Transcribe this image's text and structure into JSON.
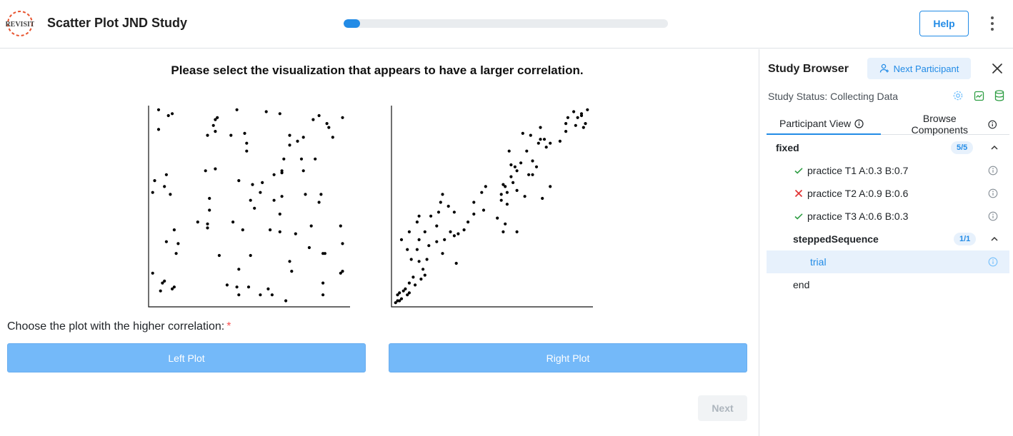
{
  "header": {
    "logo_text": "REVISIT",
    "title": "Scatter Plot JND Study",
    "progress_fraction": 0.05,
    "help_label": "Help",
    "menu_icon": "dots-vertical-icon"
  },
  "main": {
    "prompt": "Please select the visualization that appears to have a larger correlation.",
    "question": "Choose the plot with the higher correlation:",
    "required_mark": "*",
    "left_choice": "Left Plot",
    "right_choice": "Right Plot",
    "next_label": "Next"
  },
  "sidebar": {
    "title": "Study Browser",
    "next_participant_label": "Next Participant",
    "status": "Study Status: Collecting Data",
    "tabs": [
      {
        "label": "Participant View"
      },
      {
        "label": "Browse Components"
      }
    ],
    "tree": [
      {
        "label": "fixed",
        "type": "block",
        "badge": "5/5"
      },
      {
        "label": "practice T1 A:0.3 B:0.7",
        "type": "item",
        "result": "correct"
      },
      {
        "label": "practice T2 A:0.9 B:0.6",
        "type": "item",
        "result": "wrong"
      },
      {
        "label": "practice T3 A:0.6 B:0.3",
        "type": "item",
        "result": "correct"
      },
      {
        "label": "steppedSequence",
        "type": "block",
        "badge": "1/1"
      },
      {
        "label": "trial",
        "type": "item",
        "result": "active"
      },
      {
        "label": "end",
        "type": "plain"
      }
    ],
    "colors": {
      "accent": "#228be6",
      "correct": "#2f9e44",
      "wrong": "#e03131"
    }
  },
  "chart_data": [
    {
      "type": "scatter",
      "xlim": [
        0,
        1
      ],
      "ylim": [
        0,
        1
      ],
      "points": [
        [
          0.04,
          0.99
        ],
        [
          0.09,
          0.96
        ],
        [
          0.11,
          0.97
        ],
        [
          0.04,
          0.89
        ],
        [
          0.34,
          0.95
        ],
        [
          0.33,
          0.94
        ],
        [
          0.32,
          0.91
        ],
        [
          0.44,
          0.99
        ],
        [
          0.59,
          0.98
        ],
        [
          0.66,
          0.97
        ],
        [
          0.86,
          0.96
        ],
        [
          0.9,
          0.92
        ],
        [
          0.91,
          0.9
        ],
        [
          0.98,
          0.95
        ],
        [
          0.83,
          0.94
        ],
        [
          0.33,
          0.88
        ],
        [
          0.29,
          0.86
        ],
        [
          0.41,
          0.86
        ],
        [
          0.48,
          0.87
        ],
        [
          0.49,
          0.82
        ],
        [
          0.49,
          0.78
        ],
        [
          0.71,
          0.86
        ],
        [
          0.78,
          0.85
        ],
        [
          0.75,
          0.83
        ],
        [
          0.71,
          0.81
        ],
        [
          0.93,
          0.85
        ],
        [
          0.68,
          0.74
        ],
        [
          0.77,
          0.74
        ],
        [
          0.67,
          0.68
        ],
        [
          0.84,
          0.74
        ],
        [
          0.67,
          0.67
        ],
        [
          0.63,
          0.66
        ],
        [
          0.78,
          0.68
        ],
        [
          0.28,
          0.68
        ],
        [
          0.33,
          0.69
        ],
        [
          0.45,
          0.63
        ],
        [
          0.57,
          0.62
        ],
        [
          0.52,
          0.61
        ],
        [
          0.56,
          0.57
        ],
        [
          0.67,
          0.55
        ],
        [
          0.63,
          0.53
        ],
        [
          0.79,
          0.56
        ],
        [
          0.86,
          0.52
        ],
        [
          0.08,
          0.66
        ],
        [
          0.02,
          0.63
        ],
        [
          0.07,
          0.6
        ],
        [
          0.1,
          0.56
        ],
        [
          0.01,
          0.57
        ],
        [
          0.3,
          0.54
        ],
        [
          0.51,
          0.53
        ],
        [
          0.66,
          0.46
        ],
        [
          0.3,
          0.48
        ],
        [
          0.42,
          0.42
        ],
        [
          0.53,
          0.49
        ],
        [
          0.47,
          0.38
        ],
        [
          0.61,
          0.38
        ],
        [
          0.66,
          0.37
        ],
        [
          0.74,
          0.36
        ],
        [
          0.82,
          0.4
        ],
        [
          0.97,
          0.4
        ],
        [
          0.87,
          0.56
        ],
        [
          0.24,
          0.42
        ],
        [
          0.29,
          0.39
        ],
        [
          0.12,
          0.38
        ],
        [
          0.29,
          0.41
        ],
        [
          0.81,
          0.29
        ],
        [
          0.98,
          0.31
        ],
        [
          0.08,
          0.32
        ],
        [
          0.14,
          0.31
        ],
        [
          0.89,
          0.26
        ],
        [
          0.88,
          0.26
        ],
        [
          0.13,
          0.26
        ],
        [
          0.35,
          0.25
        ],
        [
          0.51,
          0.25
        ],
        [
          0.71,
          0.22
        ],
        [
          0.01,
          0.16
        ],
        [
          0.06,
          0.11
        ],
        [
          0.07,
          0.12
        ],
        [
          0.12,
          0.09
        ],
        [
          0.11,
          0.08
        ],
        [
          0.45,
          0.18
        ],
        [
          0.72,
          0.17
        ],
        [
          0.39,
          0.1
        ],
        [
          0.44,
          0.09
        ],
        [
          0.5,
          0.09
        ],
        [
          0.6,
          0.08
        ],
        [
          0.88,
          0.11
        ],
        [
          0.05,
          0.07
        ],
        [
          0.45,
          0.05
        ],
        [
          0.56,
          0.05
        ],
        [
          0.62,
          0.05
        ],
        [
          0.88,
          0.05
        ],
        [
          0.69,
          0.02
        ],
        [
          0.98,
          0.17
        ],
        [
          0.97,
          0.16
        ]
      ]
    },
    {
      "type": "scatter",
      "xlim": [
        0,
        1
      ],
      "ylim": [
        0,
        1
      ],
      "points": [
        [
          0.01,
          0.01
        ],
        [
          0.02,
          0.02
        ],
        [
          0.03,
          0.02
        ],
        [
          0.04,
          0.03
        ],
        [
          0.02,
          0.05
        ],
        [
          0.03,
          0.06
        ],
        [
          0.05,
          0.07
        ],
        [
          0.06,
          0.08
        ],
        [
          0.08,
          0.06
        ],
        [
          0.07,
          0.05
        ],
        [
          0.08,
          0.11
        ],
        [
          0.11,
          0.1
        ],
        [
          0.14,
          0.13
        ],
        [
          0.16,
          0.15
        ],
        [
          0.1,
          0.14
        ],
        [
          0.15,
          0.18
        ],
        [
          0.09,
          0.23
        ],
        [
          0.13,
          0.22
        ],
        [
          0.17,
          0.23
        ],
        [
          0.25,
          0.26
        ],
        [
          0.32,
          0.21
        ],
        [
          0.12,
          0.28
        ],
        [
          0.07,
          0.28
        ],
        [
          0.18,
          0.3
        ],
        [
          0.22,
          0.32
        ],
        [
          0.26,
          0.33
        ],
        [
          0.04,
          0.33
        ],
        [
          0.13,
          0.33
        ],
        [
          0.08,
          0.37
        ],
        [
          0.16,
          0.37
        ],
        [
          0.31,
          0.35
        ],
        [
          0.29,
          0.37
        ],
        [
          0.33,
          0.36
        ],
        [
          0.22,
          0.4
        ],
        [
          0.38,
          0.42
        ],
        [
          0.36,
          0.38
        ],
        [
          0.12,
          0.42
        ],
        [
          0.13,
          0.45
        ],
        [
          0.19,
          0.45
        ],
        [
          0.23,
          0.47
        ],
        [
          0.24,
          0.52
        ],
        [
          0.25,
          0.56
        ],
        [
          0.28,
          0.5
        ],
        [
          0.31,
          0.47
        ],
        [
          0.41,
          0.46
        ],
        [
          0.46,
          0.48
        ],
        [
          0.63,
          0.37
        ],
        [
          0.56,
          0.37
        ],
        [
          0.57,
          0.41
        ],
        [
          0.53,
          0.44
        ],
        [
          0.58,
          0.51
        ],
        [
          0.55,
          0.53
        ],
        [
          0.58,
          0.57
        ],
        [
          0.41,
          0.52
        ],
        [
          0.45,
          0.57
        ],
        [
          0.47,
          0.6
        ],
        [
          0.56,
          0.61
        ],
        [
          0.61,
          0.62
        ],
        [
          0.6,
          0.65
        ],
        [
          0.57,
          0.6
        ],
        [
          0.63,
          0.68
        ],
        [
          0.69,
          0.66
        ],
        [
          0.62,
          0.7
        ],
        [
          0.6,
          0.71
        ],
        [
          0.73,
          0.7
        ],
        [
          0.65,
          0.72
        ],
        [
          0.59,
          0.78
        ],
        [
          0.68,
          0.78
        ],
        [
          0.71,
          0.73
        ],
        [
          0.74,
          0.82
        ],
        [
          0.77,
          0.84
        ],
        [
          0.7,
          0.86
        ],
        [
          0.78,
          0.8
        ],
        [
          0.8,
          0.82
        ],
        [
          0.75,
          0.84
        ],
        [
          0.85,
          0.83
        ],
        [
          0.66,
          0.87
        ],
        [
          0.75,
          0.9
        ],
        [
          0.88,
          0.92
        ],
        [
          0.93,
          0.91
        ],
        [
          0.89,
          0.95
        ],
        [
          0.96,
          0.96
        ],
        [
          0.99,
          0.99
        ],
        [
          0.92,
          0.98
        ],
        [
          0.96,
          0.97
        ],
        [
          0.94,
          0.95
        ],
        [
          0.98,
          0.92
        ],
        [
          0.97,
          0.9
        ],
        [
          0.88,
          0.88
        ],
        [
          0.8,
          0.6
        ],
        [
          0.71,
          0.66
        ],
        [
          0.67,
          0.55
        ],
        [
          0.76,
          0.54
        ],
        [
          0.55,
          0.56
        ],
        [
          0.63,
          0.58
        ]
      ]
    }
  ]
}
